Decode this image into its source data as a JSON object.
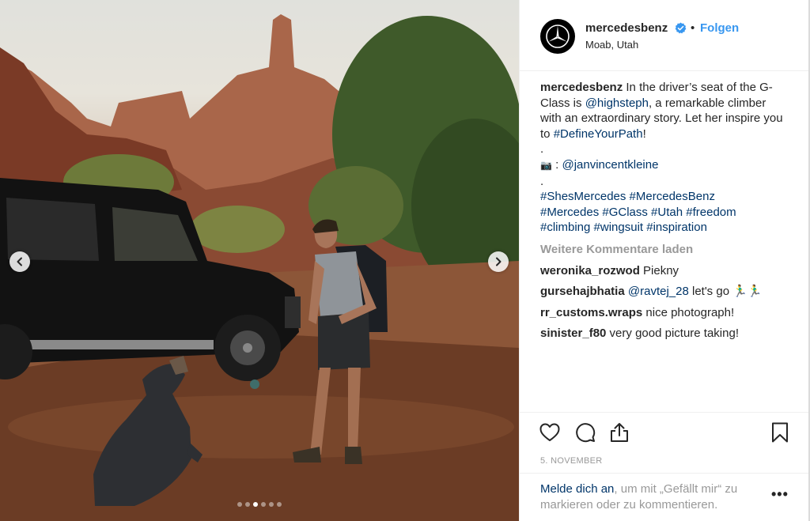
{
  "post": {
    "image_alt": "",
    "carousel": {
      "count": 6,
      "active_index": 2
    }
  },
  "header": {
    "username": "mercedesbenz",
    "separator": "•",
    "follow_label": "Folgen",
    "location": "Moab, Utah"
  },
  "caption": {
    "username": "mercedesbenz",
    "text_1": " In the driver’s seat of the G-Class is ",
    "mention": "@highsteph",
    "text_2": ", a remarkable climber with an extraordinary story. Let her inspire you to ",
    "hashtag": "#DefineYourPath",
    "text_3": "!",
    "dot_1": ".",
    "camera_emoji": "📷",
    "credit_prefix": " : ",
    "credit": "@janvincentkleine",
    "dot_2": ".",
    "hashtags_line_1": "#ShesMercedes #MercedesBenz",
    "hashtags_line_2": "#Mercedes #GClass #Utah #freedom",
    "hashtags_line_3": "#climbing #wingsuit #inspiration"
  },
  "load_more": "Weitere Kommentare laden",
  "comments": [
    {
      "user": "weronika_rozwod",
      "text": " Piekny"
    },
    {
      "user": "gursehajbhatia",
      "mention": "@ravtej_28",
      "text": " let's go 🏃‍♂️🏃‍♂️"
    },
    {
      "user": "rr_customs.wraps",
      "text": " nice photograph!"
    },
    {
      "user": "sinister_f80",
      "text": " very good picture taking!"
    }
  ],
  "date": "5. NOVEMBER",
  "login": {
    "link": "Melde dich an",
    "text": ", um mit „Gefällt mir“ zu markieren oder zu kommentieren.",
    "more": "•••"
  },
  "colors": {
    "link": "#003569",
    "follow": "#3897f0",
    "muted": "#999999",
    "text": "#262626"
  },
  "icons": [
    "mercedes-star-icon",
    "verified-badge-icon",
    "heart-icon",
    "comment-icon",
    "share-icon",
    "bookmark-icon",
    "chevron-left-icon",
    "chevron-right-icon"
  ]
}
